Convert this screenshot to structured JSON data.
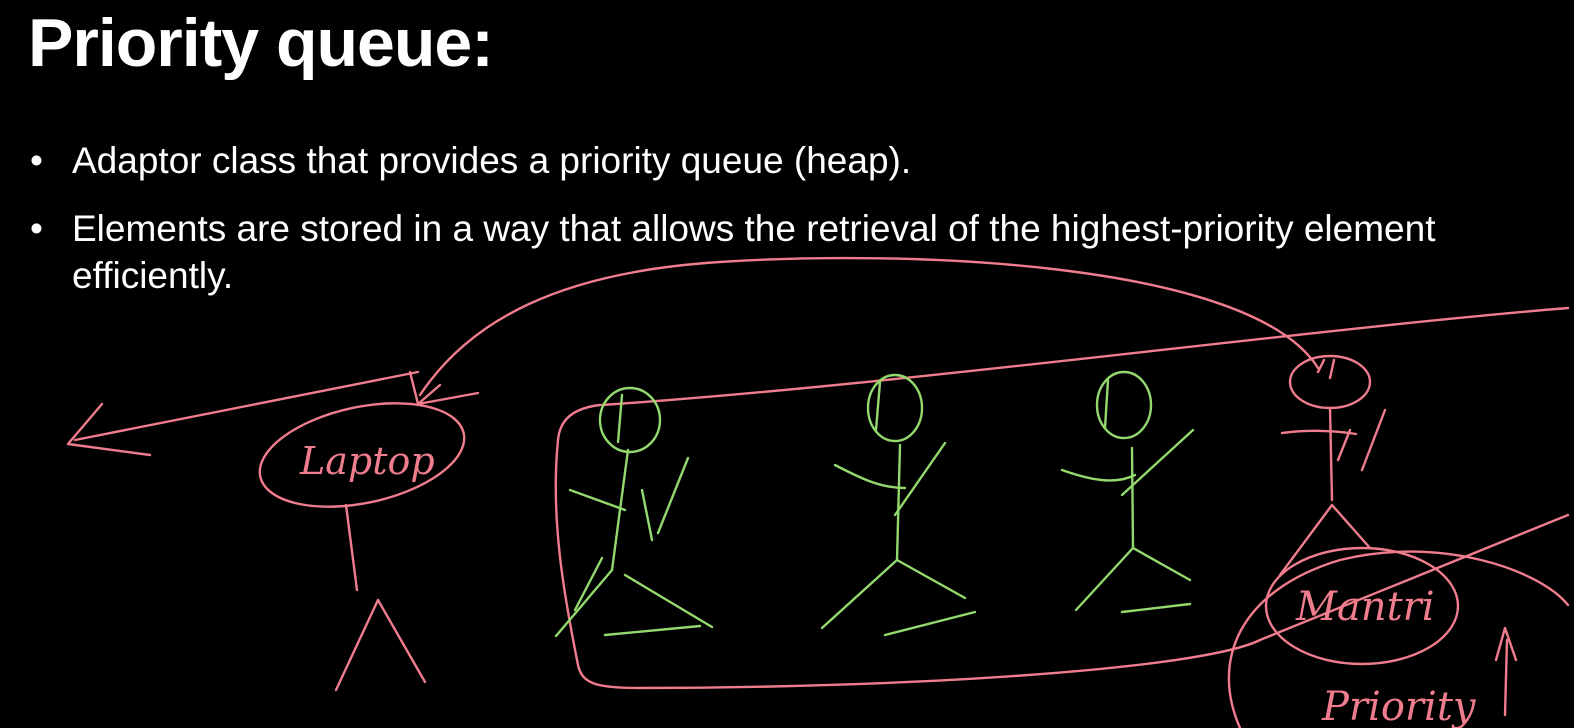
{
  "slide": {
    "title": "Priority queue:",
    "bullets": [
      {
        "marker": "•",
        "text": "Adaptor class that provides a priority queue (heap)."
      },
      {
        "marker": "•",
        "text": "Elements are stored in a way that allows the retrieval of the highest-priority element efficiently."
      }
    ]
  },
  "annotations": {
    "labels": {
      "left_person": "Laptop",
      "right_person": "Mantri",
      "bottom_right": "Priority"
    },
    "colors": {
      "background": "#000000",
      "text": "#ffffff",
      "pink_ink": "#f07d8d",
      "green_ink": "#93d96e"
    }
  }
}
